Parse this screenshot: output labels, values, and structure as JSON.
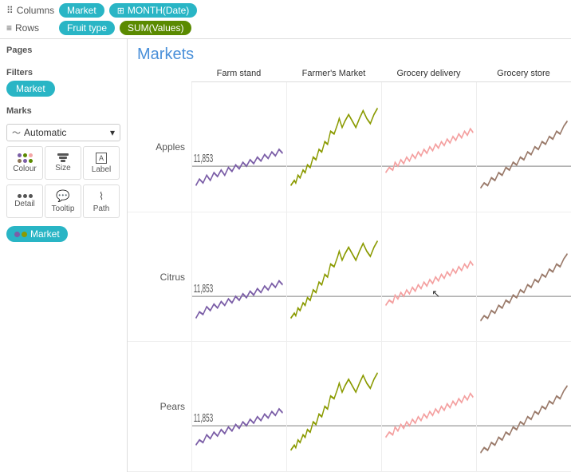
{
  "topbar": {
    "columns_icon": "⠿",
    "columns_label": "Columns",
    "rows_icon": "≡",
    "rows_label": "Rows",
    "pill_market": "Market",
    "pill_month": "MONTH(Date)",
    "pill_fruit": "Fruit type",
    "pill_sum": "SUM(Values)"
  },
  "sidebar": {
    "pages_label": "Pages",
    "filters_label": "Filters",
    "market_filter": "Market",
    "marks_label": "Marks",
    "auto_label": "Automatic",
    "colour_label": "Colour",
    "size_label": "Size",
    "label_label": "Label",
    "detail_label": "Detail",
    "tooltip_label": "Tooltip",
    "path_label": "Path",
    "market_mark": "Market"
  },
  "chart": {
    "title": "Markets",
    "col_headers": [
      "Farm stand",
      "Farmer's Market",
      "Grocery delivery",
      "Grocery store"
    ],
    "row_labels": [
      "Apples",
      "Citrus",
      "Pears"
    ],
    "ref_value": "11,853"
  },
  "colors": {
    "purple": "#7b5ea7",
    "olive": "#8a9a00",
    "pink": "#f4a0a0",
    "brown": "#9a7a6a",
    "accent": "#29b5c5"
  }
}
